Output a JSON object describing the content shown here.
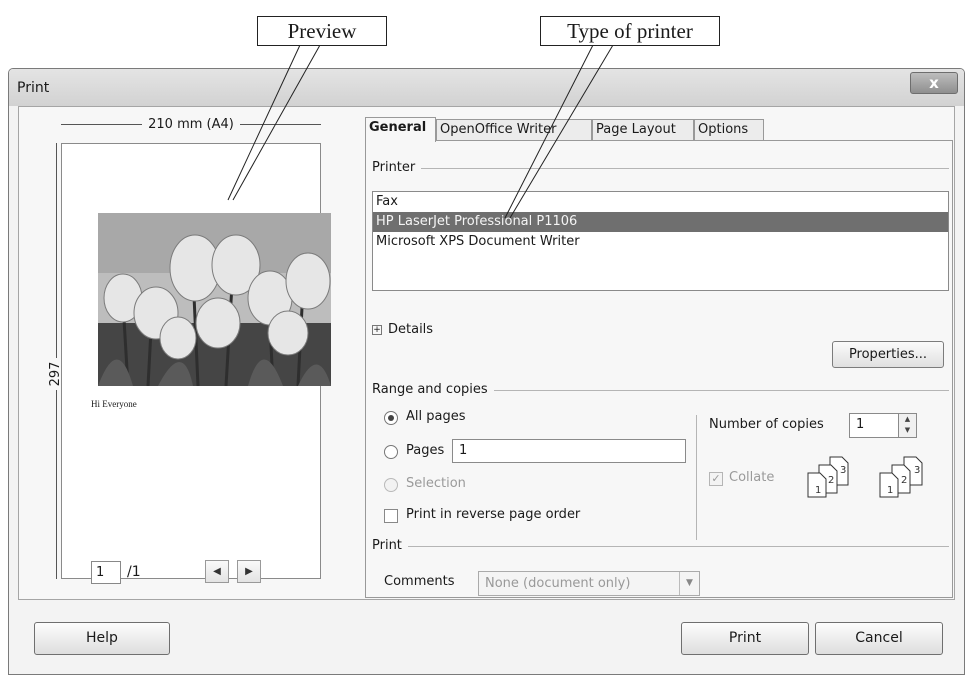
{
  "callouts": {
    "preview": "Preview",
    "printer_type": "Type of printer"
  },
  "dialog": {
    "title": "Print",
    "close_label": "x"
  },
  "preview": {
    "width_label": "210 mm (A4)",
    "height_label": "297 mm",
    "page_caption": "Hi Everyone",
    "current_page": "1",
    "total_pages": "/1"
  },
  "tabs": [
    "General",
    "OpenOffice Writer",
    "Page Layout",
    "Options"
  ],
  "printer": {
    "group_label": "Printer",
    "items": [
      "Fax",
      "HP LaserJet Professional P1106",
      "Microsoft XPS Document Writer"
    ],
    "selected_index": 1,
    "details_label": "Details",
    "properties_label": "Properties..."
  },
  "range": {
    "group_label": "Range and copies",
    "all_pages": "All pages",
    "pages": "Pages",
    "pages_value": "1",
    "selection": "Selection",
    "reverse_order": "Print in reverse page order",
    "copies_label": "Number of copies",
    "copies_value": "1",
    "collate_label": "Collate"
  },
  "print_section": {
    "group_label": "Print",
    "comments_label": "Comments",
    "comments_value": "None (document only)"
  },
  "footer": {
    "help": "Help",
    "print": "Print",
    "cancel": "Cancel"
  }
}
